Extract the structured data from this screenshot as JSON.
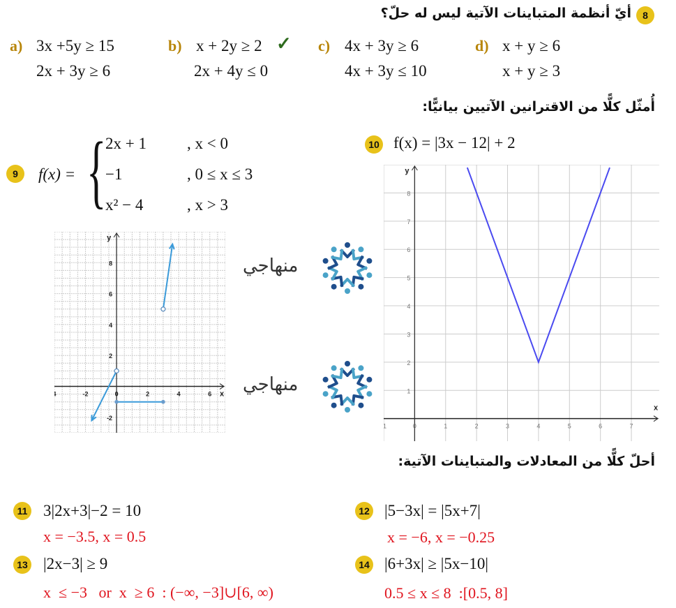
{
  "q8": {
    "number": "8",
    "question": "أيّ أنظمة المتباينات الآتية ليس له حلّ؟",
    "options": [
      {
        "label": "a)",
        "line1": "3x +5y ≥ 15",
        "line2": "2x + 3y ≥ 6",
        "checked": false
      },
      {
        "label": "b)",
        "line1": "x + 2y ≥ 2",
        "line2": "2x + 4y ≤ 0",
        "checked": true
      },
      {
        "label": "c)",
        "line1": "4x + 3y ≥ 6",
        "line2": "4x + 3y ≤ 10",
        "checked": false
      },
      {
        "label": "d)",
        "line1": "x + y ≥ 6",
        "line2": "x + y ≥ 3",
        "checked": false
      }
    ],
    "check_mark": "✓"
  },
  "section_graph": {
    "heading": "أُمثّل كلًّا من الاقترانين الآتيين بيانيًّا:"
  },
  "q9": {
    "number": "9",
    "lhs": "f(x) =",
    "cases": [
      {
        "expr": "2x + 1",
        "cond": ", x < 0"
      },
      {
        "expr": "−1",
        "cond": ", 0 ≤ x ≤ 3"
      },
      {
        "expr": "x² − 4",
        "cond": ", x > 3"
      }
    ]
  },
  "q10": {
    "number": "10",
    "expr": "f(x) = |3x − 12| + 2"
  },
  "logo": {
    "text": "منهاجي"
  },
  "chart_data": [
    {
      "type": "line",
      "title": "",
      "xlabel": "x",
      "ylabel": "y",
      "xlim": [
        -4,
        7
      ],
      "ylim": [
        -3,
        10
      ],
      "grid": true,
      "xticks": [
        "4",
        "-2",
        "0",
        "2",
        "4",
        "6"
      ],
      "yticks": [
        "-2",
        "2",
        "4",
        "6",
        "8"
      ],
      "series": [
        {
          "points": [
            [
              -1.6,
              -2.2
            ],
            [
              -1,
              -1
            ],
            [
              0,
              1
            ]
          ],
          "start": "arrow",
          "end": "open"
        },
        {
          "points": [
            [
              0,
              -1
            ],
            [
              3,
              -1
            ]
          ],
          "start": "closed",
          "end": "closed"
        },
        {
          "points": [
            [
              3,
              5
            ],
            [
              3.6,
              9.2
            ]
          ],
          "start": "open",
          "end": "arrow"
        }
      ],
      "color": "#3a9ad9"
    },
    {
      "type": "line",
      "title": "",
      "xlabel": "x",
      "ylabel": "y",
      "xlim": [
        -1,
        7.9
      ],
      "ylim": [
        -0.8,
        9
      ],
      "grid": true,
      "xticks": [
        "-1",
        "0",
        "1",
        "2",
        "3",
        "4",
        "5",
        "6",
        "7"
      ],
      "yticks": [
        "1",
        "2",
        "3",
        "4",
        "5",
        "6",
        "7",
        "8"
      ],
      "series": [
        {
          "points": [
            [
              1.7,
              8.9
            ],
            [
              4,
              2
            ],
            [
              6.3,
              8.9
            ]
          ]
        }
      ],
      "color": "#4a4af0"
    }
  ],
  "section_solve": {
    "heading": "أحلّ كلًّا من المعادلات والمتباينات الآتية:"
  },
  "problems": [
    {
      "number": "11",
      "expr": "3|2x+3|−2 = 10",
      "answer": "x = −3.5, x = 0.5"
    },
    {
      "number": "12",
      "expr": "|5−3x| = |5x+7|",
      "answer": "x = −6, x = −0.25"
    },
    {
      "number": "13",
      "expr": "|2x−3| ≥ 9",
      "answer": "x  ≤ −3   or  x  ≥ 6  : (−∞, −3]∪[6, ∞)"
    },
    {
      "number": "14",
      "expr": "|6+3x| ≥ |5x−10|",
      "answer": "0.5 ≤ x ≤ 8  :[0.5, 8]"
    }
  ]
}
